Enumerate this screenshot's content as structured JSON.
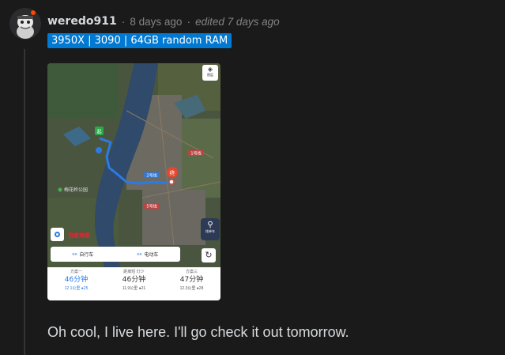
{
  "comment": {
    "username": "weredo911",
    "posted": "8 days ago",
    "edited": "edited 7 days ago",
    "flair": "3950X | 3090 | 64GB random RAM",
    "body": "Oh cool, I live here. I'll go check it out tomorrow."
  },
  "map": {
    "top_button_label": "图层",
    "end_marker": "终",
    "start_marker": "起",
    "labels": [
      "2号线",
      "5号线",
      "1号线",
      "梅花岭公园"
    ],
    "brand": "百度地图",
    "modes": [
      {
        "icon": "bicycle-icon",
        "label": "自行车"
      },
      {
        "icon": "scooter-icon",
        "label": "电动车"
      }
    ],
    "bike_button_label": "找单车",
    "routes": [
      {
        "name": "方案一",
        "time": "46分钟",
        "distance": "12.1公里",
        "lights": "25",
        "selected": true
      },
      {
        "name": "距离短 灯少",
        "time": "46分钟",
        "distance": "11.9公里",
        "lights": "21",
        "selected": false
      },
      {
        "name": "方案三",
        "time": "47分钟",
        "distance": "12.3公里",
        "lights": "28",
        "selected": false
      }
    ]
  },
  "colors": {
    "background": "#1a1a1b",
    "flair_bg": "#0079d3",
    "route": "#2b7be6",
    "marker": "#e8452c"
  }
}
